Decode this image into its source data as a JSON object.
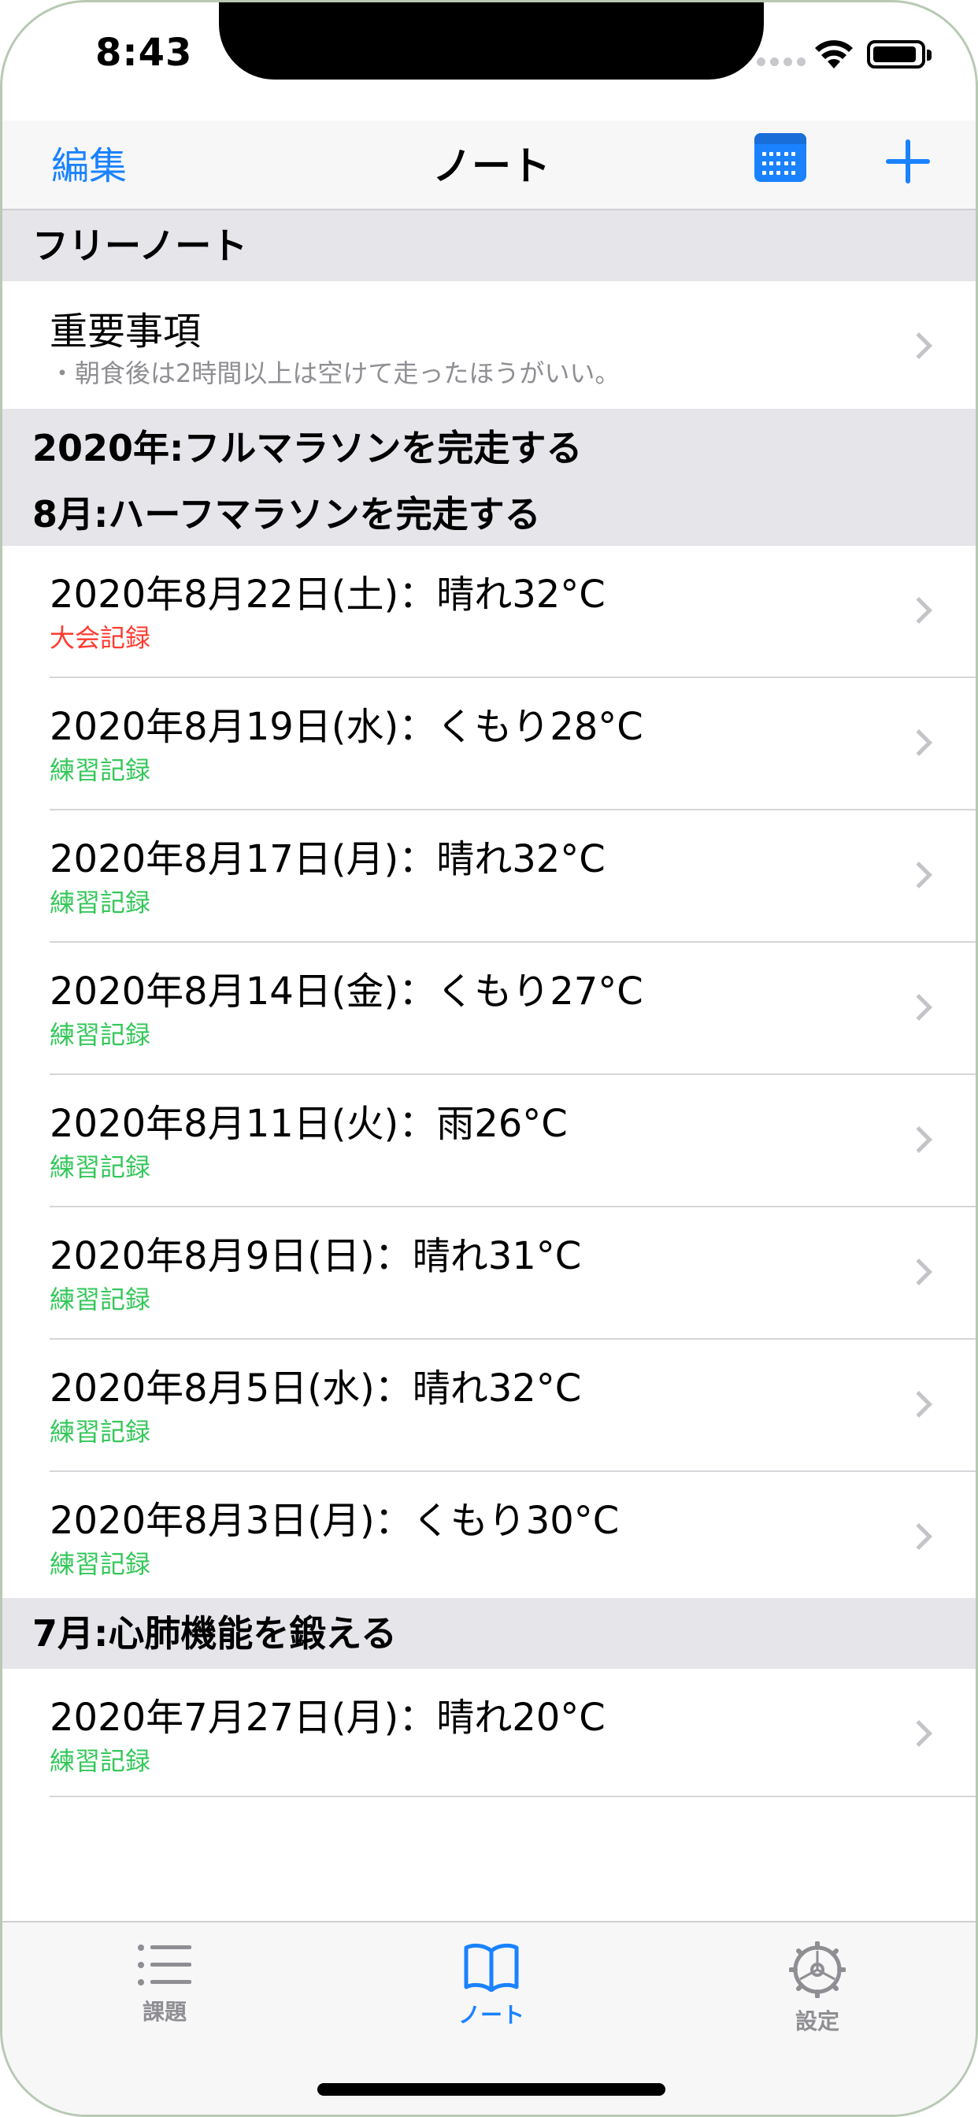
{
  "status": {
    "time": "8:43"
  },
  "nav": {
    "edit": "編集",
    "title": "ノート"
  },
  "free_section": {
    "header": "フリーノート",
    "item": {
      "title": "重要事項",
      "subtitle": "・朝食後は2時間以上は空けて走ったほうがいい。"
    }
  },
  "goal_section": {
    "year_line": "2020年:フルマラソンを完走する",
    "month_line": "8月:ハーフマラソンを完走する",
    "items": [
      {
        "title": "2020年8月22日(土)：晴れ32°C",
        "tag": "大会記録",
        "tag_color": "#ff3b30"
      },
      {
        "title": "2020年8月19日(水)：くもり28°C",
        "tag": "練習記録",
        "tag_color": "#34c759"
      },
      {
        "title": "2020年8月17日(月)：晴れ32°C",
        "tag": "練習記録",
        "tag_color": "#34c759"
      },
      {
        "title": "2020年8月14日(金)：くもり27°C",
        "tag": "練習記録",
        "tag_color": "#34c759"
      },
      {
        "title": "2020年8月11日(火)：雨26°C",
        "tag": "練習記録",
        "tag_color": "#34c759"
      },
      {
        "title": "2020年8月9日(日)：晴れ31°C",
        "tag": "練習記録",
        "tag_color": "#34c759"
      },
      {
        "title": "2020年8月5日(水)：晴れ32°C",
        "tag": "練習記録",
        "tag_color": "#34c759"
      },
      {
        "title": "2020年8月3日(月)：くもり30°C",
        "tag": "練習記録",
        "tag_color": "#34c759"
      }
    ]
  },
  "july_section": {
    "header": "7月:心肺機能を鍛える",
    "items": [
      {
        "title": "2020年7月27日(月)：晴れ20°C",
        "tag": "練習記録",
        "tag_color": "#34c759"
      }
    ]
  },
  "tabs": [
    {
      "label": "課題",
      "icon": "list-icon",
      "active": false
    },
    {
      "label": "ノート",
      "icon": "book-icon",
      "active": true
    },
    {
      "label": "設定",
      "icon": "gear-icon",
      "active": false
    }
  ],
  "colors": {
    "accent": "#1a82ff",
    "inactive": "#8e8e93"
  }
}
